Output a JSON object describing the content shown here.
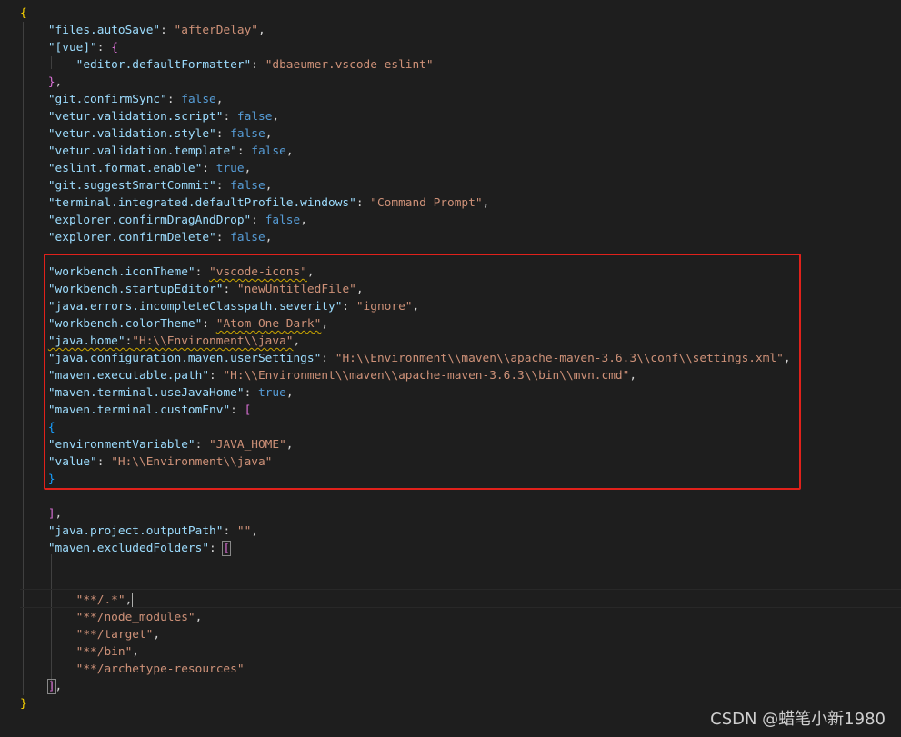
{
  "editor": {
    "lines": {
      "l1": {
        "brace": "{"
      },
      "l2": {
        "key": "\"files.autoSave\"",
        "colon": ": ",
        "val": "\"afterDelay\"",
        "end": ","
      },
      "l3": {
        "key": "\"[vue]\"",
        "colon": ": ",
        "brace": "{"
      },
      "l4": {
        "key": "\"editor.defaultFormatter\"",
        "colon": ": ",
        "val": "\"dbaeumer.vscode-eslint\""
      },
      "l5": {
        "brace": "}",
        "end": ","
      },
      "l6": {
        "key": "\"git.confirmSync\"",
        "colon": ": ",
        "val": "false",
        "end": ","
      },
      "l7": {
        "key": "\"vetur.validation.script\"",
        "colon": ": ",
        "val": "false",
        "end": ","
      },
      "l8": {
        "key": "\"vetur.validation.style\"",
        "colon": ": ",
        "val": "false",
        "end": ","
      },
      "l9": {
        "key": "\"vetur.validation.template\"",
        "colon": ": ",
        "val": "false",
        "end": ","
      },
      "l10": {
        "key": "\"eslint.format.enable\"",
        "colon": ": ",
        "val": "true",
        "end": ","
      },
      "l11": {
        "key": "\"git.suggestSmartCommit\"",
        "colon": ": ",
        "val": "false",
        "end": ","
      },
      "l12": {
        "key": "\"terminal.integrated.defaultProfile.windows\"",
        "colon": ": ",
        "val": "\"Command Prompt\"",
        "end": ","
      },
      "l13": {
        "key": "\"explorer.confirmDragAndDrop\"",
        "colon": ": ",
        "val": "false",
        "end": ","
      },
      "l14": {
        "key": "\"explorer.confirmDelete\"",
        "colon": ": ",
        "val": "false",
        "end": ","
      },
      "l16": {
        "key": "\"workbench.iconTheme\"",
        "colon": ": ",
        "val": "\"vscode-icons\"",
        "end": ","
      },
      "l17": {
        "key": "\"workbench.startupEditor\"",
        "colon": ": ",
        "val": "\"newUntitledFile\"",
        "end": ","
      },
      "l18": {
        "key": "\"java.errors.incompleteClasspath.severity\"",
        "colon": ": ",
        "val": "\"ignore\"",
        "end": ","
      },
      "l19": {
        "key": "\"workbench.colorTheme\"",
        "colon": ": ",
        "val": "\"Atom One Dark\"",
        "end": ","
      },
      "l20": {
        "key": "\"java.home\"",
        "colon": ":",
        "val": "\"H:\\\\Environment\\\\java\"",
        "end": ","
      },
      "l21": {
        "key": "\"java.configuration.maven.userSettings\"",
        "colon": ": ",
        "val": "\"H:\\\\Environment\\\\maven\\\\apache-maven-3.6.3\\\\conf\\\\settings.xml\"",
        "end": ","
      },
      "l22": {
        "key": "\"maven.executable.path\"",
        "colon": ": ",
        "val": "\"H:\\\\Environment\\\\maven\\\\apache-maven-3.6.3\\\\bin\\\\mvn.cmd\"",
        "end": ","
      },
      "l23": {
        "key": "\"maven.terminal.useJavaHome\"",
        "colon": ": ",
        "val": "true",
        "end": ","
      },
      "l24": {
        "key": "\"maven.terminal.customEnv\"",
        "colon": ": ",
        "brace": "["
      },
      "l25": {
        "brace": "{"
      },
      "l26": {
        "key": "\"environmentVariable\"",
        "colon": ": ",
        "val": "\"JAVA_HOME\"",
        "end": ","
      },
      "l27": {
        "key": "\"value\"",
        "colon": ": ",
        "val": "\"H:\\\\Environment\\\\java\""
      },
      "l28": {
        "brace": "}"
      },
      "l30": {
        "brace": "]",
        "end": ","
      },
      "l31": {
        "key": "\"java.project.outputPath\"",
        "colon": ": ",
        "val": "\"\"",
        "end": ","
      },
      "l32": {
        "key": "\"maven.excludedFolders\"",
        "colon": ": ",
        "brace": "["
      },
      "l35": {
        "val": "\"**/.*\"",
        "end": ","
      },
      "l36": {
        "val": "\"**/node_modules\"",
        "end": ","
      },
      "l37": {
        "val": "\"**/target\"",
        "end": ","
      },
      "l38": {
        "val": "\"**/bin\"",
        "end": ","
      },
      "l39": {
        "val": "\"**/archetype-resources\""
      },
      "l40": {
        "brace": "]",
        "end": ","
      },
      "l41": {
        "brace": "}"
      }
    }
  },
  "watermark": "CSDN @蜡笔小新1980"
}
